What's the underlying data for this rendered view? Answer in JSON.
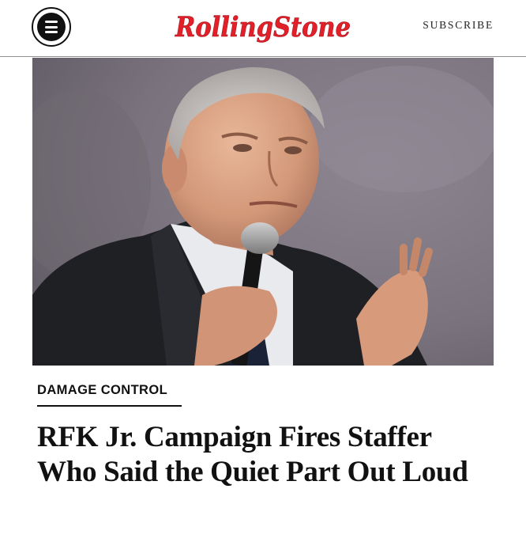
{
  "header": {
    "menu_icon": "hamburger-menu-icon",
    "logo_text": "RollingStone",
    "logo_color": "#e2202a",
    "subscribe_label": "SUBSCRIBE"
  },
  "hero": {
    "icon": "photo"
  },
  "article": {
    "category": "DAMAGE CONTROL",
    "headline": "RFK Jr. Campaign Fires Staffer Who Said the Quiet Part Out Loud"
  }
}
